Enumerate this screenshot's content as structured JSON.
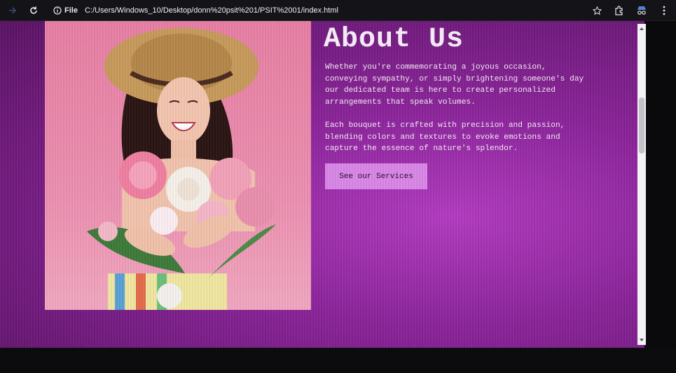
{
  "browser": {
    "site_info_label": "File",
    "url": "C:/Users/Windows_10/Desktop/donn%20psit%201/PSIT%2001/index.html"
  },
  "page": {
    "title": "About Us",
    "paragraph1": "Whether you're commemorating a joyous occasion, conveying sympathy, or simply brightening someone's day our dedicated team is here to create personalized arrangements that speak volumes.",
    "paragraph2": "Each bouquet is crafted with precision and passion, blending colors and textures to evoke emotions and capture the essence of nature's splendor.",
    "cta_label": "See our Services"
  },
  "colors": {
    "page_background": "#8a2399",
    "button_background": "#d986e6",
    "text": "#f5ecf6"
  }
}
